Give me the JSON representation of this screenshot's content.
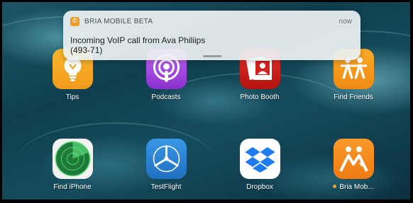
{
  "notification": {
    "app_name": "BRIA MOBILE BETA",
    "time": "now",
    "title": "Incoming VoIP call from Ava Philiips",
    "subtitle": "(493-71)",
    "badge_glyph": "✆"
  },
  "apps_row1": [
    {
      "label": "Tips",
      "icon": "tips-lightbulb-icon",
      "color": "#f5a623"
    },
    {
      "label": "Podcasts",
      "icon": "podcasts-icon",
      "color": "#9b40d8"
    },
    {
      "label": "Photo Booth",
      "icon": "photo-booth-icon",
      "color": "#d4201e"
    },
    {
      "label": "Find Friends",
      "icon": "find-friends-icon",
      "color": "#f59a1b"
    }
  ],
  "apps_row2": [
    {
      "label": "Find iPhone",
      "icon": "find-iphone-radar-icon",
      "color": "#3a3a3a"
    },
    {
      "label": "TestFlight",
      "icon": "testflight-icon",
      "color": "#2f86d8"
    },
    {
      "label": "Dropbox",
      "icon": "dropbox-icon",
      "color": "#ffffff"
    },
    {
      "label": "Bria Mob...",
      "icon": "bria-mobile-icon",
      "color": "#f5871f",
      "badge": "update-dot"
    }
  ]
}
